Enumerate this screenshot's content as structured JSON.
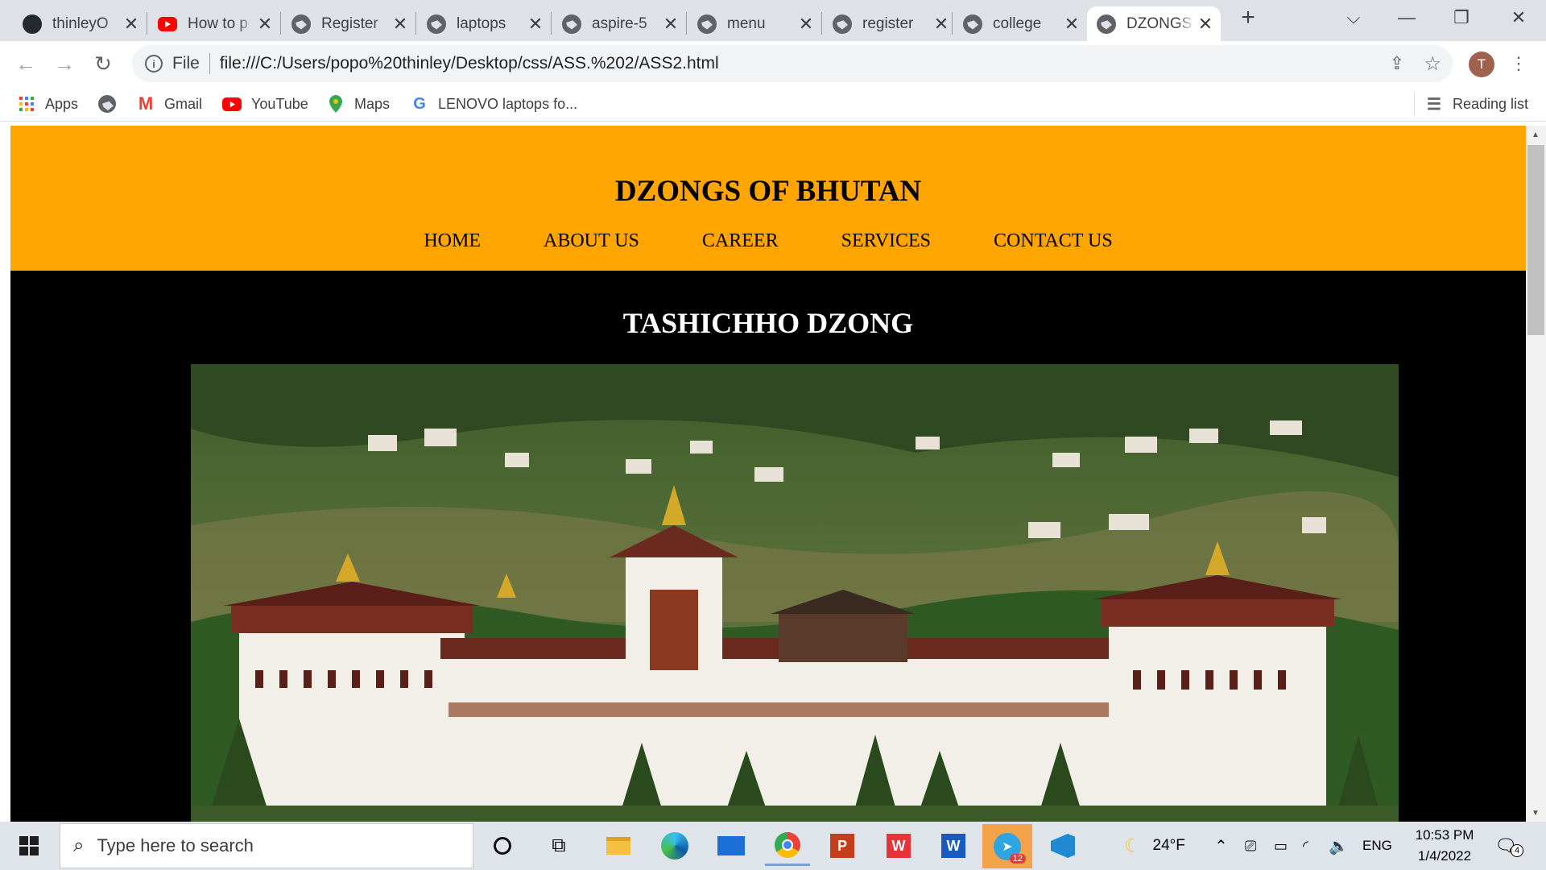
{
  "browser": {
    "tabs": [
      {
        "label": "thinleyO",
        "icon": "github-icon"
      },
      {
        "label": "How to p",
        "icon": "youtube-icon"
      },
      {
        "label": "Register",
        "icon": "globe-icon"
      },
      {
        "label": "laptops",
        "icon": "globe-icon"
      },
      {
        "label": "aspire-5",
        "icon": "globe-icon"
      },
      {
        "label": "menu",
        "icon": "globe-icon"
      },
      {
        "label": "register",
        "icon": "globe-icon"
      },
      {
        "label": "college",
        "icon": "globe-icon"
      },
      {
        "label": "DZONGS",
        "icon": "globe-icon",
        "active": true
      }
    ],
    "new_tab": "+",
    "address": {
      "scheme_label": "File",
      "url": "file:///C:/Users/popo%20thinley/Desktop/css/ASS.%202/ASS2.html"
    },
    "profile_initial": "T",
    "bookmarks": [
      {
        "label": "Apps",
        "icon": "apps-grid-icon"
      },
      {
        "label": "",
        "icon": "globe-icon"
      },
      {
        "label": "Gmail",
        "icon": "gmail-icon"
      },
      {
        "label": "YouTube",
        "icon": "youtube-icon"
      },
      {
        "label": "Maps",
        "icon": "maps-icon"
      },
      {
        "label": "LENOVO laptops fo...",
        "icon": "google-icon"
      }
    ],
    "reading_list": "Reading list"
  },
  "site": {
    "title": "DZONGS OF BHUTAN",
    "nav": [
      "HOME",
      "ABOUT US",
      "CAREER",
      "SERVICES",
      "CONTACT US"
    ],
    "heading": "TASHICHHO DZONG",
    "colors": {
      "header": "#ffa500",
      "content_bg": "#000000",
      "heading_text": "#ffffff"
    }
  },
  "taskbar": {
    "search_placeholder": "Type here to search",
    "weather": "24°F",
    "language": "ENG",
    "time": "10:53 PM",
    "date": "1/4/2022",
    "telegram_badge": "12",
    "notifications": "4"
  }
}
